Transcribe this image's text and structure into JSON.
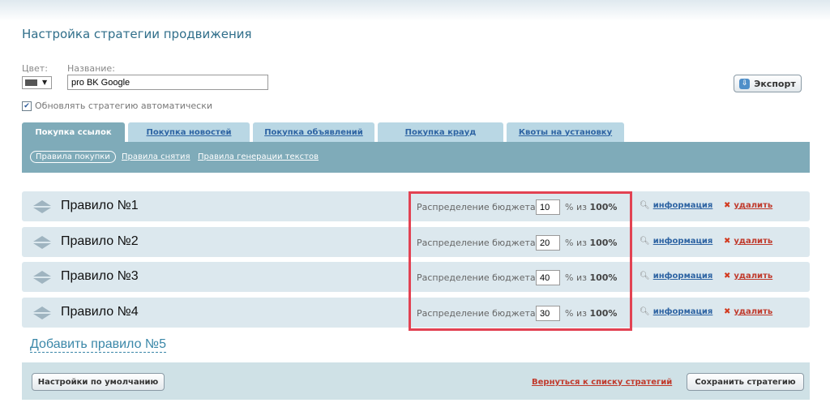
{
  "title": "Настройка стратегии продвижения",
  "form": {
    "color_label": "Цвет:",
    "color_value": "#555555",
    "name_label": "Название:",
    "name_value": "pro BK Google",
    "auto_update_label": "Обновлять стратегию автоматически",
    "auto_update_checked": true
  },
  "export_label": "Экспорт",
  "tabs": [
    {
      "label": "Покупка ссылок",
      "active": true
    },
    {
      "label": "Покупка новостей",
      "active": false
    },
    {
      "label": "Покупка объявлений",
      "active": false
    },
    {
      "label": "Покупка крауд",
      "active": false
    },
    {
      "label": "Квоты на установку",
      "active": false
    }
  ],
  "subtabs": [
    {
      "label": "Правила покупки",
      "active": true
    },
    {
      "label": "Правила снятия",
      "active": false
    },
    {
      "label": "Правила генерации текстов",
      "active": false
    }
  ],
  "rules": [
    {
      "title": "Правило №1",
      "budget_label": "Распределение бюджета:",
      "budget_value": "10",
      "pct_text": "% из",
      "total": "100%",
      "info_label": "информация",
      "delete_label": "удалить"
    },
    {
      "title": "Правило №2",
      "budget_label": "Распределение бюджета:",
      "budget_value": "20",
      "pct_text": "% из",
      "total": "100%",
      "info_label": "информация",
      "delete_label": "удалить"
    },
    {
      "title": "Правило №3",
      "budget_label": "Распределение бюджета:",
      "budget_value": "40",
      "pct_text": "% из",
      "total": "100%",
      "info_label": "информация",
      "delete_label": "удалить"
    },
    {
      "title": "Правило №4",
      "budget_label": "Распределение бюджета:",
      "budget_value": "30",
      "pct_text": "% из",
      "total": "100%",
      "info_label": "информация",
      "delete_label": "удалить"
    }
  ],
  "add_rule_label": "Добавить правило №5",
  "footer": {
    "defaults_label": "Настройки по умолчанию",
    "back_label": "Вернуться к списку стратегий",
    "save_label": "Сохранить стратегию"
  },
  "colors": {
    "accent_bar": "#7fabb9",
    "row_bg": "#dce8ee",
    "link_blue": "#2e64a3",
    "link_red": "#c0392b",
    "highlight": "#e24252"
  }
}
